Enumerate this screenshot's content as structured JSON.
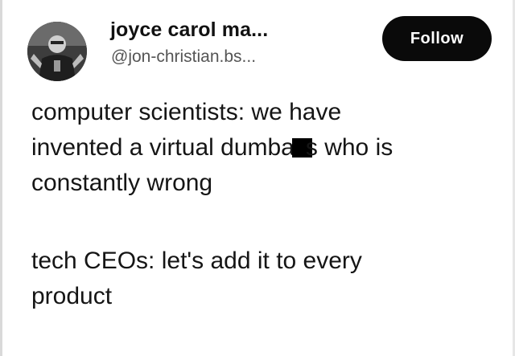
{
  "author": {
    "display_name": "joyce carol ma...",
    "handle": "@jon-christian.bs..."
  },
  "follow_label": "Follow",
  "post": {
    "paragraph1": {
      "line1": "computer scientists: we have",
      "line2_before": "invented a virtual dumba",
      "line2_after": "s who is",
      "line3": "constantly wrong"
    },
    "paragraph2": {
      "line1": "tech CEOs: let's add it to every",
      "line2": "product"
    }
  },
  "colors": {
    "follow_button_bg": "#0a0a0a",
    "follow_button_text": "#ffffff",
    "text": "#151515",
    "handle": "#555555",
    "censor_bar": "#000000"
  }
}
